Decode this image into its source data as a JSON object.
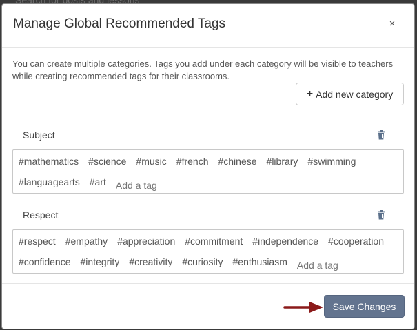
{
  "backdrop": {
    "text": "Search for posts and lessons"
  },
  "modal": {
    "title": "Manage Global Recommended Tags",
    "close_label": "×",
    "description": "You can create multiple categories. Tags you add under each category will be visible to teachers while creating recommended tags for their classrooms.",
    "add_category_label": "Add new category",
    "categories": [
      {
        "title": "Subject",
        "tags": [
          "#mathematics",
          "#science",
          "#music",
          "#french",
          "#chinese",
          "#library",
          "#swimming",
          "#languagearts",
          "#art"
        ],
        "placeholder": "Add a tag"
      },
      {
        "title": "Respect",
        "tags": [
          "#respect",
          "#empathy",
          "#appreciation",
          "#commitment",
          "#independence",
          "#cooperation",
          "#confidence",
          "#integrity",
          "#creativity",
          "#curiosity",
          "#enthusiasm"
        ],
        "placeholder": "Add a tag"
      }
    ],
    "save_label": "Save Changes"
  },
  "colors": {
    "save_button": "#63748f",
    "arrow": "#8b1a1a",
    "trash": "#5a6f8a"
  }
}
